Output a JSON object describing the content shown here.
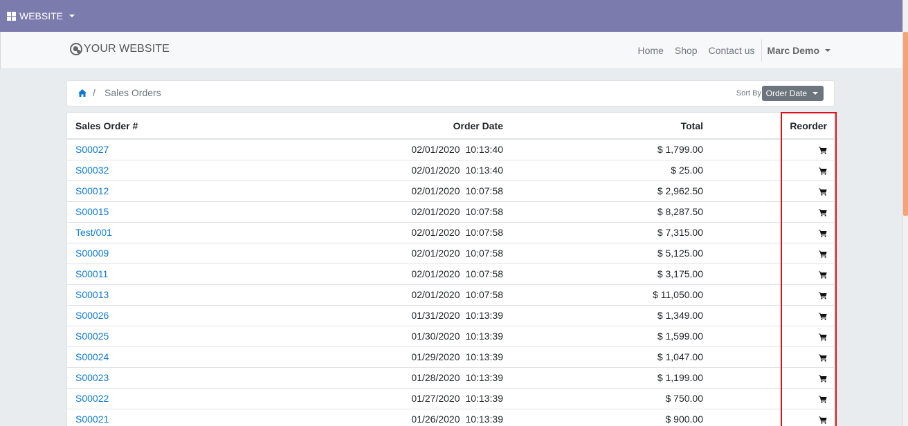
{
  "admin_bar": {
    "menu_label": "WEBSITE"
  },
  "header": {
    "logo_text": "YOUR WEBSITE",
    "nav": [
      {
        "label": "Home"
      },
      {
        "label": "Shop"
      },
      {
        "label": "Contact us"
      }
    ],
    "user_name": "Marc Demo"
  },
  "breadcrumb": {
    "current": "Sales Orders",
    "separator": "/"
  },
  "sort": {
    "label": "Sort By:",
    "value": "Order Date"
  },
  "table": {
    "headers": {
      "order": "Sales Order #",
      "date": "Order Date",
      "total": "Total",
      "reorder": "Reorder"
    },
    "rows": [
      {
        "order": "S00027",
        "date": "02/01/2020",
        "time": "10:13:40",
        "total": "$ 1,799.00"
      },
      {
        "order": "S00032",
        "date": "02/01/2020",
        "time": "10:13:40",
        "total": "$ 25.00"
      },
      {
        "order": "S00012",
        "date": "02/01/2020",
        "time": "10:07:58",
        "total": "$ 2,962.50"
      },
      {
        "order": "S00015",
        "date": "02/01/2020",
        "time": "10:07:58",
        "total": "$ 8,287.50"
      },
      {
        "order": "Test/001",
        "date": "02/01/2020",
        "time": "10:07:58",
        "total": "$ 7,315.00"
      },
      {
        "order": "S00009",
        "date": "02/01/2020",
        "time": "10:07:58",
        "total": "$ 5,125.00"
      },
      {
        "order": "S00011",
        "date": "02/01/2020",
        "time": "10:07:58",
        "total": "$ 3,175.00"
      },
      {
        "order": "S00013",
        "date": "02/01/2020",
        "time": "10:07:58",
        "total": "$ 11,050.00"
      },
      {
        "order": "S00026",
        "date": "01/31/2020",
        "time": "10:13:39",
        "total": "$ 1,349.00"
      },
      {
        "order": "S00025",
        "date": "01/30/2020",
        "time": "10:13:39",
        "total": "$ 1,599.00"
      },
      {
        "order": "S00024",
        "date": "01/29/2020",
        "time": "10:13:39",
        "total": "$ 1,047.00"
      },
      {
        "order": "S00023",
        "date": "01/28/2020",
        "time": "10:13:39",
        "total": "$ 1,199.00"
      },
      {
        "order": "S00022",
        "date": "01/27/2020",
        "time": "10:13:39",
        "total": "$ 750.00"
      },
      {
        "order": "S00021",
        "date": "01/26/2020",
        "time": "10:13:39",
        "total": "$ 900.00"
      }
    ]
  },
  "icons": {
    "apps": "grid-icon",
    "logo": "globe-icon",
    "home": "home-icon",
    "reorder": "cart-icon"
  },
  "colors": {
    "admin_bar": "#7c7bad",
    "link": "#0d79d7",
    "highlight": "#d9131a",
    "sort_button": "#6c757d"
  }
}
